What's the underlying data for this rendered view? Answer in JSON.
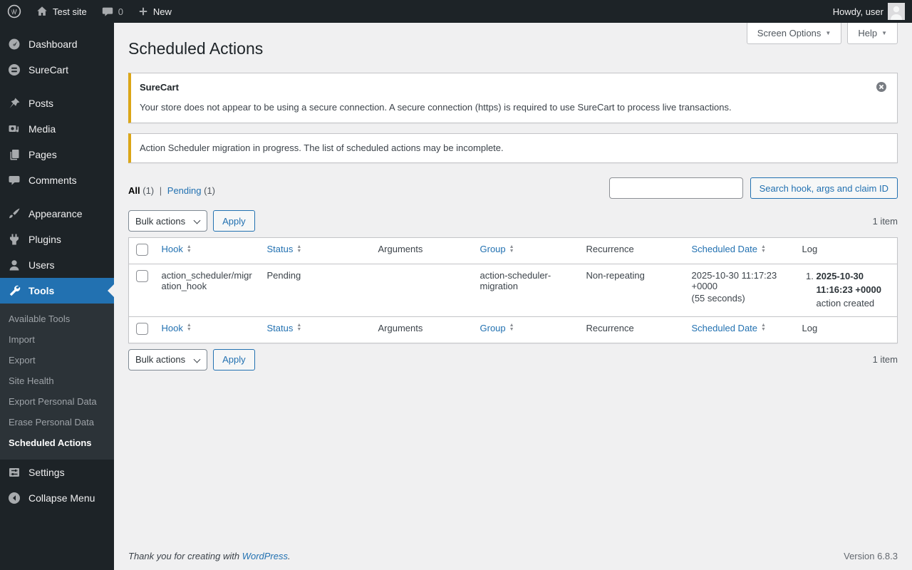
{
  "admin_bar": {
    "site_name": "Test site",
    "comments_count": "0",
    "new_label": "New",
    "howdy": "Howdy, user"
  },
  "sidebar": {
    "items": [
      {
        "label": "Dashboard",
        "icon": "dashboard-icon"
      },
      {
        "label": "SureCart",
        "icon": "surecart-icon"
      },
      {
        "label": "Posts",
        "icon": "pin-icon"
      },
      {
        "label": "Media",
        "icon": "media-icon"
      },
      {
        "label": "Pages",
        "icon": "pages-icon"
      },
      {
        "label": "Comments",
        "icon": "comments-icon"
      },
      {
        "label": "Appearance",
        "icon": "appearance-icon"
      },
      {
        "label": "Plugins",
        "icon": "plugin-icon"
      },
      {
        "label": "Users",
        "icon": "users-icon"
      },
      {
        "label": "Tools",
        "icon": "tools-icon",
        "active": true
      },
      {
        "label": "Settings",
        "icon": "settings-icon"
      },
      {
        "label": "Collapse Menu",
        "icon": "collapse-icon"
      }
    ],
    "tools_submenu": [
      {
        "label": "Available Tools"
      },
      {
        "label": "Import"
      },
      {
        "label": "Export"
      },
      {
        "label": "Site Health"
      },
      {
        "label": "Export Personal Data"
      },
      {
        "label": "Erase Personal Data"
      },
      {
        "label": "Scheduled Actions",
        "current": true
      }
    ]
  },
  "header": {
    "title": "Scheduled Actions",
    "screen_options_label": "Screen Options",
    "help_label": "Help"
  },
  "notices": [
    {
      "title": "SureCart",
      "message": "Your store does not appear to be using a secure connection. A secure connection (https) is required to use SureCart to process live transactions.",
      "dismissible": true
    },
    {
      "message": "Action Scheduler migration in progress. The list of scheduled actions may be incomplete."
    }
  ],
  "filters": {
    "all_label": "All",
    "all_count": "(1)",
    "separator": "|",
    "pending_label": "Pending",
    "pending_count": "(1)"
  },
  "search": {
    "value": "",
    "button_label": "Search hook, args and claim ID"
  },
  "bulk": {
    "select_label": "Bulk actions",
    "apply_label": "Apply",
    "item_count": "1 item"
  },
  "table": {
    "columns": [
      {
        "label": "Hook",
        "sortable": true
      },
      {
        "label": "Status",
        "sortable": true
      },
      {
        "label": "Arguments",
        "sortable": false
      },
      {
        "label": "Group",
        "sortable": true
      },
      {
        "label": "Recurrence",
        "sortable": false
      },
      {
        "label": "Scheduled Date",
        "sortable": true
      },
      {
        "label": "Log",
        "sortable": false
      }
    ],
    "rows": [
      {
        "hook": "action_scheduler/migration_hook",
        "status": "Pending",
        "arguments": "",
        "group": "action-scheduler-migration",
        "recurrence": "Non-repeating",
        "scheduled_date": "2025-10-30 11:17:23 +0000",
        "scheduled_delta": "(55 seconds)",
        "log_timestamp": "2025-10-30 11:16:23 +0000",
        "log_message": "action created"
      }
    ]
  },
  "footer": {
    "thanks_prefix": "Thank you for creating with ",
    "link_label": "WordPress",
    "suffix": ".",
    "version": "Version 6.8.3"
  },
  "colors": {
    "accent": "#2271b1",
    "warning_border": "#dba617",
    "admin_bar_bg": "#1d2327",
    "submenu_bg": "#2c3338",
    "content_bg": "#f0f0f1"
  },
  "icons": {
    "dropdown_arrow": "▼",
    "sort_arrows": "▲▼",
    "dismiss": "circled-x",
    "plus": "+"
  }
}
